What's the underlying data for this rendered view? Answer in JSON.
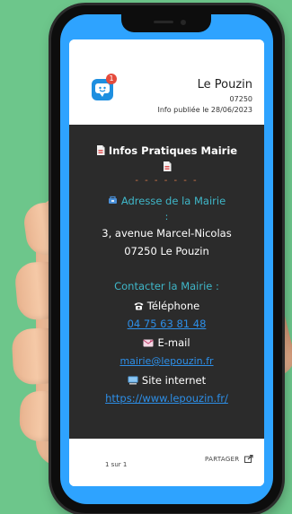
{
  "header": {
    "commune": "Le Pouzin",
    "postcode": "07250",
    "published": "Info publiée le 28/06/2023",
    "notification_count": "1"
  },
  "content": {
    "title": "Infos Pratiques Mairie",
    "dashes": "- - - - - - -",
    "address_title": "Adresse de la Mairie",
    "colon": ":",
    "street": "3, avenue Marcel-Nicolas",
    "city": "07250 Le Pouzin",
    "contact_title": "Contacter la Mairie :",
    "phone_label": "Téléphone",
    "phone_number": "04 75 63 81 48",
    "email_label": "E-mail",
    "email_address": "mairie@lepouzin.fr",
    "site_label": "Site internet",
    "site_url": "https://www.lepouzin.fr/"
  },
  "footer": {
    "pager": "1 sur 1",
    "share_label": "PARTAGER"
  },
  "icons": {
    "doc": "document-icon",
    "pin": "pushpin-icon",
    "phone": "telephone-icon",
    "email": "envelope-icon",
    "site": "computer-icon",
    "share": "share-icon",
    "app": "chat-bubble-icon"
  },
  "colors": {
    "background": "#6dc68b",
    "screen_frame": "#2ea3ff",
    "content_background": "#2b2b2b",
    "accent_teal": "#3fb7c9",
    "link": "#2d8fe8",
    "badge": "#e54b3c"
  }
}
